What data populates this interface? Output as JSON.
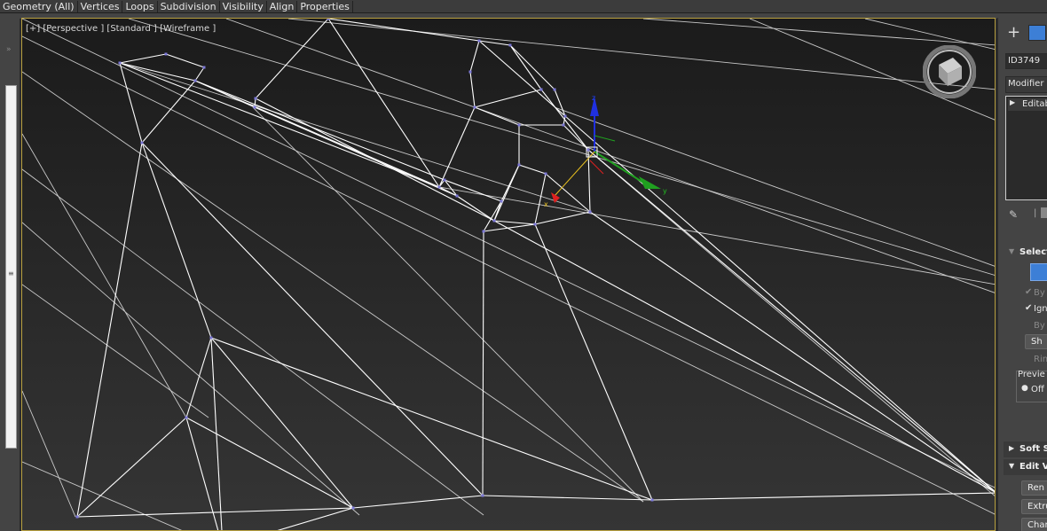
{
  "menubar": {
    "items": [
      "Geometry (All)",
      "Vertices",
      "Loops",
      "Subdivision",
      "Visibility",
      "Align",
      "Properties"
    ]
  },
  "viewport": {
    "label": "[+] [Perspective ] [Standard ] [Wireframe ]",
    "gizmo_axes": [
      "x",
      "y",
      "z"
    ]
  },
  "right_panel": {
    "object_name": "ID3749",
    "modifier_list": "Modifier Li",
    "stack_item": "Editab",
    "selection_header": "Select",
    "by_vertex": "By V",
    "ignore_backfacing": "Ign",
    "by_angle": "By A",
    "shrink": "Sh",
    "ring": "Rin",
    "preview_label": "Previe",
    "preview_off": "Off",
    "soft_selection": "Soft S",
    "edit_vertices": "Edit Ve",
    "remove": "Ren",
    "extrude": "Extru",
    "chamfer": "Cham"
  },
  "colors": {
    "viewport_border": "#b8a040",
    "vertex": "#7c78d8",
    "wire": "#e6e6e6",
    "gizmo_x": "#e02020",
    "gizmo_y": "#20a020",
    "gizmo_z": "#2030e0",
    "accent_blue": "#3d7fd6"
  }
}
